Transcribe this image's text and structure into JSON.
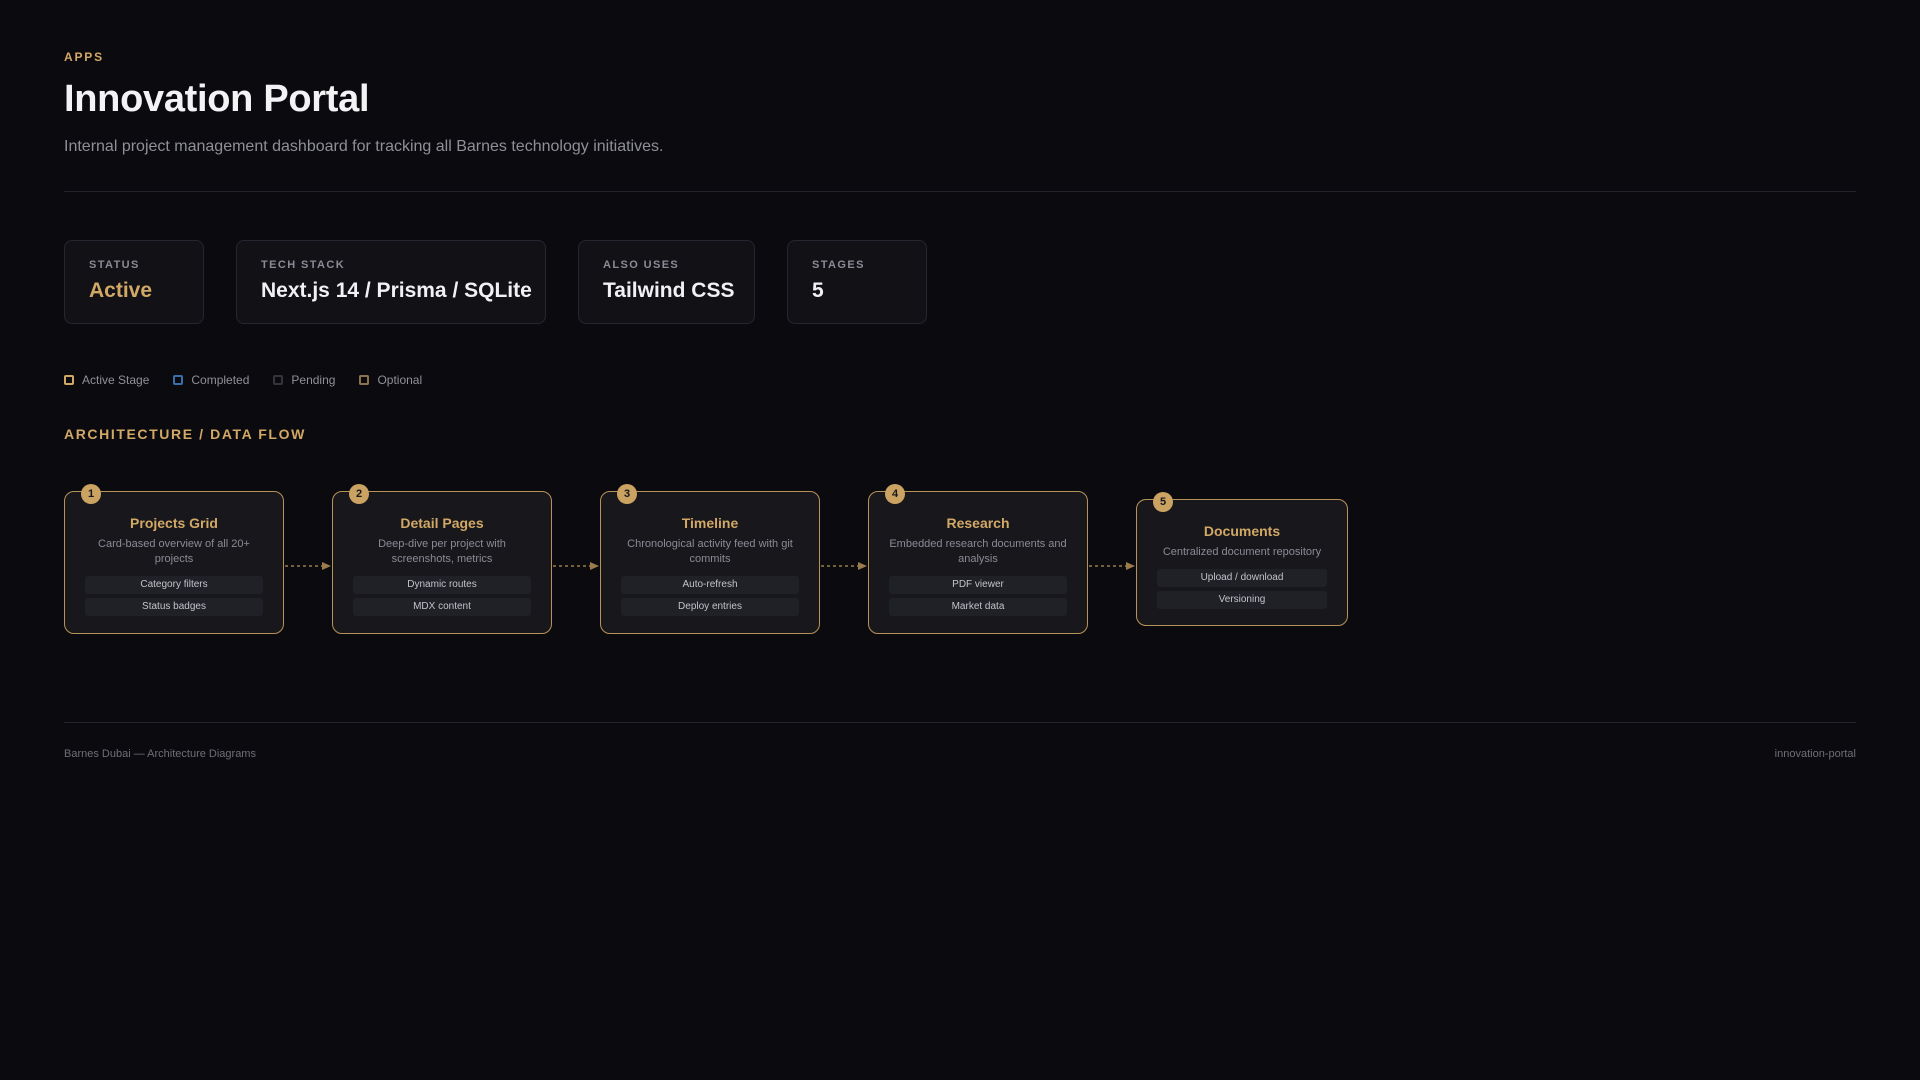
{
  "header": {
    "eyebrow": "APPS",
    "title": "Innovation Portal",
    "subtitle": "Internal project management dashboard for tracking all Barnes technology initiatives."
  },
  "stats": [
    {
      "label": "STATUS",
      "value": "Active"
    },
    {
      "label": "TECH STACK",
      "value": "Next.js 14 / Prisma / SQLite"
    },
    {
      "label": "ALSO USES",
      "value": "Tailwind CSS"
    },
    {
      "label": "STAGES",
      "value": "5"
    }
  ],
  "legend": [
    {
      "label": "Active Stage"
    },
    {
      "label": "Completed"
    },
    {
      "label": "Pending"
    },
    {
      "label": "Optional"
    }
  ],
  "section_title": "ARCHITECTURE / DATA FLOW",
  "nodes": [
    {
      "number": "1",
      "title": "Projects Grid",
      "description": "Card-based overview of all 20+ projects",
      "tags": [
        "Category filters",
        "Status badges"
      ]
    },
    {
      "number": "2",
      "title": "Detail Pages",
      "description": "Deep-dive per project with screenshots, metrics",
      "tags": [
        "Dynamic routes",
        "MDX content"
      ]
    },
    {
      "number": "3",
      "title": "Timeline",
      "description": "Chronological activity feed with git commits",
      "tags": [
        "Auto-refresh",
        "Deploy entries"
      ]
    },
    {
      "number": "4",
      "title": "Research",
      "description": "Embedded research documents and analysis",
      "tags": [
        "PDF viewer",
        "Market data"
      ]
    },
    {
      "number": "5",
      "title": "Documents",
      "description": "Centralized document repository",
      "tags": [
        "Upload / download",
        "Versioning"
      ]
    }
  ],
  "footer": {
    "left": "Barnes Dubai — Architecture Diagrams",
    "right": "innovation-portal"
  },
  "colors": {
    "background": "#0b0b0f",
    "accent": "#d2a866",
    "completed": "#3a6ea8",
    "card": "#111116"
  }
}
